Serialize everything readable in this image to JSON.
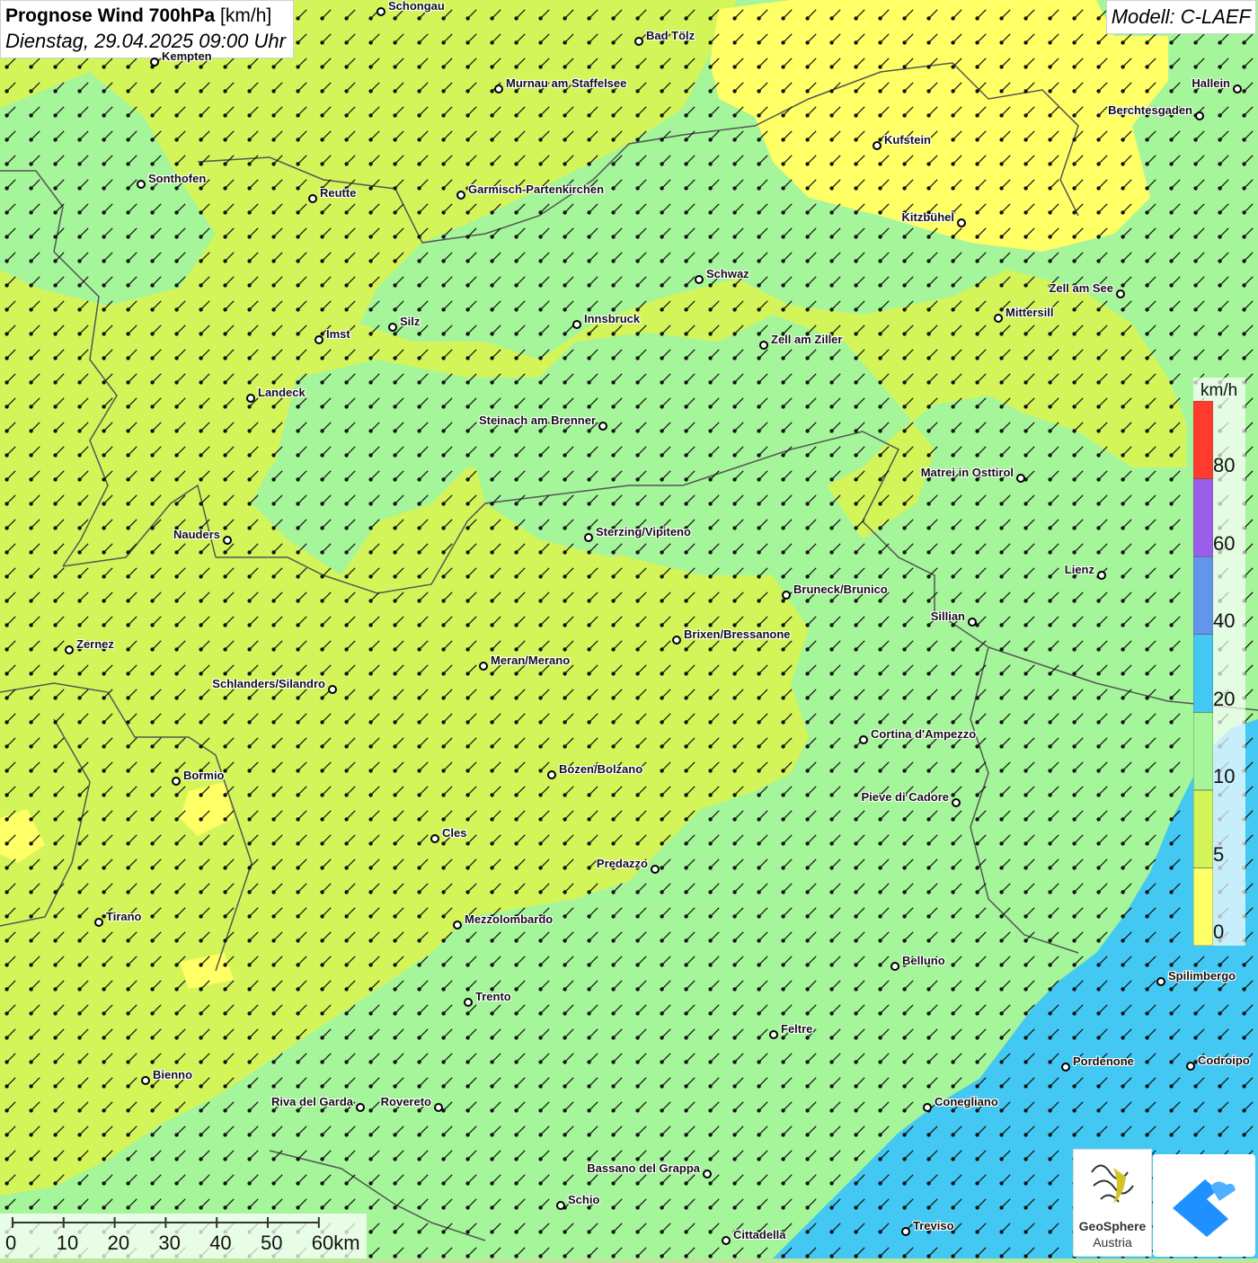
{
  "title": {
    "main_bold": "Prognose Wind 700hPa",
    "main_unit": "[km/h]",
    "datetime": "Dienstag, 29.04.2025 09:00 Uhr"
  },
  "model": "Modell: C-LAEF",
  "legend": {
    "unit": "km/h",
    "labels": [
      "0",
      "5",
      "10",
      "20",
      "40",
      "60",
      "80"
    ],
    "colors": [
      "#ffff66",
      "#d4f55a",
      "#a5f59a",
      "#42c8f2",
      "#6495ed",
      "#9b5ee8",
      "#ff3b2e"
    ]
  },
  "scalebar": {
    "labels": [
      "0",
      "10",
      "20",
      "30",
      "40",
      "50",
      "60km"
    ]
  },
  "cities": [
    {
      "name": "Schongau"
    },
    {
      "name": "Bad Tölz"
    },
    {
      "name": "Kempten"
    },
    {
      "name": "Murnau am Staffelsee"
    },
    {
      "name": "Hallein"
    },
    {
      "name": "Berchtesgaden"
    },
    {
      "name": "Kufstein"
    },
    {
      "name": "Sonthofen"
    },
    {
      "name": "Reutte"
    },
    {
      "name": "Garmisch-Partenkirchen"
    },
    {
      "name": "Kitzbühel"
    },
    {
      "name": "Schwaz"
    },
    {
      "name": "Zell am See"
    },
    {
      "name": "Mittersill"
    },
    {
      "name": "Innsbruck"
    },
    {
      "name": "Silz"
    },
    {
      "name": "Imst"
    },
    {
      "name": "Zell am Ziller"
    },
    {
      "name": "Landeck"
    },
    {
      "name": "Steinach am Brenner"
    },
    {
      "name": "Matrei in Osttirol"
    },
    {
      "name": "Nauders"
    },
    {
      "name": "Sterzing/Vipiteno"
    },
    {
      "name": "Lienz"
    },
    {
      "name": "Bruneck/Brunico"
    },
    {
      "name": "Sillian"
    },
    {
      "name": "Brixen/Bressanone"
    },
    {
      "name": "Zernez"
    },
    {
      "name": "Meran/Merano"
    },
    {
      "name": "Schlanders/Silandro"
    },
    {
      "name": "Cortina d'Ampezzo"
    },
    {
      "name": "Bormio"
    },
    {
      "name": "Bozen/Bolzano"
    },
    {
      "name": "Pieve di Cadore"
    },
    {
      "name": "Cles"
    },
    {
      "name": "Predazzo"
    },
    {
      "name": "Tirano"
    },
    {
      "name": "Mezzolombardo"
    },
    {
      "name": "Belluno"
    },
    {
      "name": "Spilimbergo"
    },
    {
      "name": "Trento"
    },
    {
      "name": "Feltre"
    },
    {
      "name": "Pordenone"
    },
    {
      "name": "Codroipo"
    },
    {
      "name": "Bienno"
    },
    {
      "name": "Riva del Garda"
    },
    {
      "name": "Rovereto"
    },
    {
      "name": "Conegliano"
    },
    {
      "name": "Bassano del Grappa"
    },
    {
      "name": "Schio"
    },
    {
      "name": "Treviso"
    },
    {
      "name": "Cittadella"
    }
  ],
  "logos": {
    "geosphere_line1": "GeoSphere",
    "geosphere_line2": "Austria"
  },
  "colors": {
    "wind_0_5": "#ffff66",
    "wind_5_10": "#d4f55a",
    "wind_10_20": "#a5f59a",
    "wind_20_40": "#42c8f2",
    "arrow": "#111111",
    "border": "#555555"
  },
  "icons": [
    "city-marker-icon",
    "wind-arrow-icon",
    "geosphere-logo-icon",
    "app-logo-icon"
  ]
}
